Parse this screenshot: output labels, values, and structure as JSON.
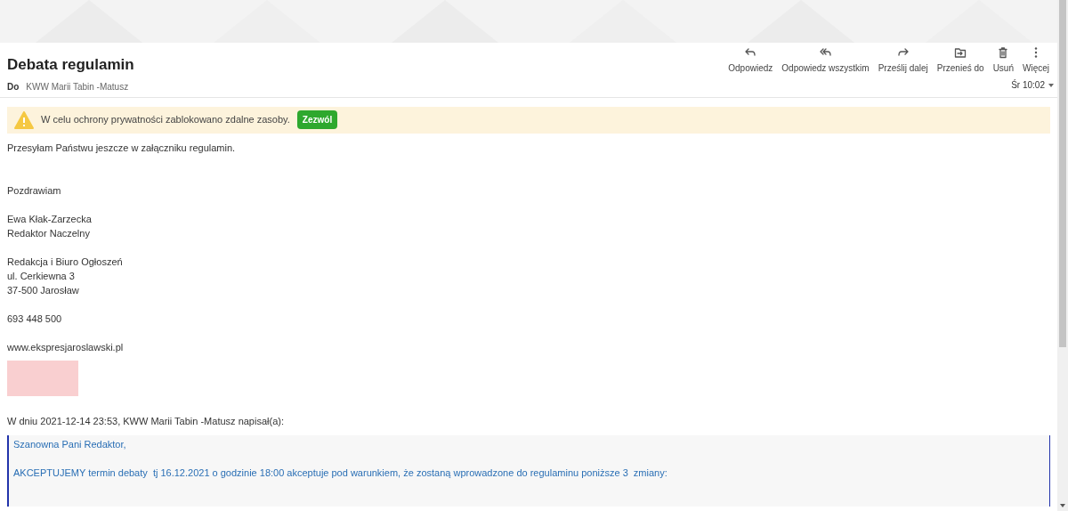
{
  "message": {
    "subject": "Debata regulamin",
    "to_label": "Do",
    "to": "KWW Marii Tabin -Matusz",
    "time": "Śr 10:02"
  },
  "actions": [
    {
      "kind": "reply",
      "label": "Odpowiedz"
    },
    {
      "kind": "reply_all",
      "label": "Odpowiedz wszystkim"
    },
    {
      "kind": "forward",
      "label": "Prześlij dalej"
    },
    {
      "kind": "move",
      "label": "Przenieś do"
    },
    {
      "kind": "delete",
      "label": "Usuń"
    },
    {
      "kind": "more",
      "label": "Więcej"
    }
  ],
  "privacy_notice": {
    "text": "W celu ochrony prywatności zablokowano zdalne zasoby.",
    "button": "Zezwól"
  },
  "body": [
    {
      "kind": "line",
      "text": "Przesyłam Państwu jeszcze w załączniku regulamin."
    },
    {
      "kind": "gap"
    },
    {
      "kind": "gap"
    },
    {
      "kind": "line",
      "text": "Pozdrawiam"
    },
    {
      "kind": "gap"
    },
    {
      "kind": "line",
      "text": "Ewa Kłak-Zarzecka"
    },
    {
      "kind": "line",
      "text": "Redaktor Naczelny"
    },
    {
      "kind": "gap"
    },
    {
      "kind": "line",
      "text": "Redakcja i Biuro Ogłoszeń"
    },
    {
      "kind": "line",
      "text": "ul. Cerkiewna 3"
    },
    {
      "kind": "line",
      "text": "37-500 Jarosław"
    },
    {
      "kind": "gap"
    },
    {
      "kind": "line",
      "text": "693 448 500"
    },
    {
      "kind": "gap"
    },
    {
      "kind": "line",
      "text": "www.ekspresjaroslawski.pl"
    },
    {
      "kind": "blocked_image"
    },
    {
      "kind": "gap"
    },
    {
      "kind": "line",
      "text": "W dniu 2021-12-14 23:53, KWW Marii Tabin -Matusz napisał(a):"
    }
  ],
  "quote": [
    "Szanowna Pani Redaktor,",
    "AKCEPTUJEMY termin debaty  tj 16.12.2021 o godzinie 18:00 akceptuje pod warunkiem, że zostaną wprowadzone do regulaminu poniższe 3  zmiany:"
  ]
}
